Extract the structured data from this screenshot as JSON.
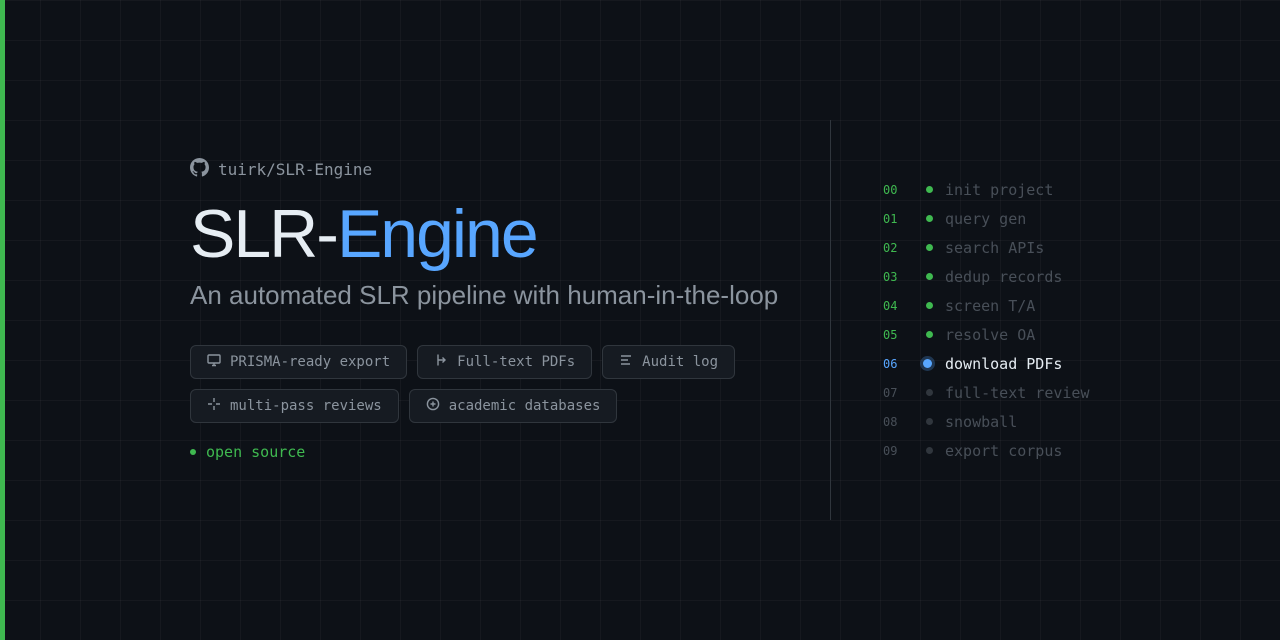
{
  "repo": {
    "icon": "github-icon",
    "name": "tuirk/SLR-Engine"
  },
  "title": {
    "part1": "SLR-",
    "part2": "Engine"
  },
  "subtitle": "An automated SLR pipeline with human-in-the-loop",
  "tags": [
    {
      "icon": "monitor-icon",
      "label": "PRISMA-ready export"
    },
    {
      "icon": "branch-arrow-icon",
      "label": "Full-text PDFs"
    },
    {
      "icon": "list-icon",
      "label": "Audit log"
    },
    {
      "icon": "sparkle-icon",
      "label": "multi-pass reviews"
    },
    {
      "icon": "plus-circle-icon",
      "label": "academic databases"
    }
  ],
  "badge": {
    "label": "open source"
  },
  "steps": [
    {
      "num": "00",
      "label": "init project",
      "state": "done"
    },
    {
      "num": "01",
      "label": "query gen",
      "state": "done"
    },
    {
      "num": "02",
      "label": "search APIs",
      "state": "done"
    },
    {
      "num": "03",
      "label": "dedup records",
      "state": "done"
    },
    {
      "num": "04",
      "label": "screen T/A",
      "state": "done"
    },
    {
      "num": "05",
      "label": "resolve OA",
      "state": "done"
    },
    {
      "num": "06",
      "label": "download PDFs",
      "state": "active"
    },
    {
      "num": "07",
      "label": "full-text review",
      "state": "pending"
    },
    {
      "num": "08",
      "label": "snowball",
      "state": "pending"
    },
    {
      "num": "09",
      "label": "export corpus",
      "state": "pending"
    }
  ],
  "colors": {
    "background": "#0d1117",
    "accent_green": "#3fb950",
    "accent_blue": "#58a6ff",
    "text_primary": "#e6edf3",
    "text_muted": "#8b949e",
    "text_dim": "#484f58"
  }
}
